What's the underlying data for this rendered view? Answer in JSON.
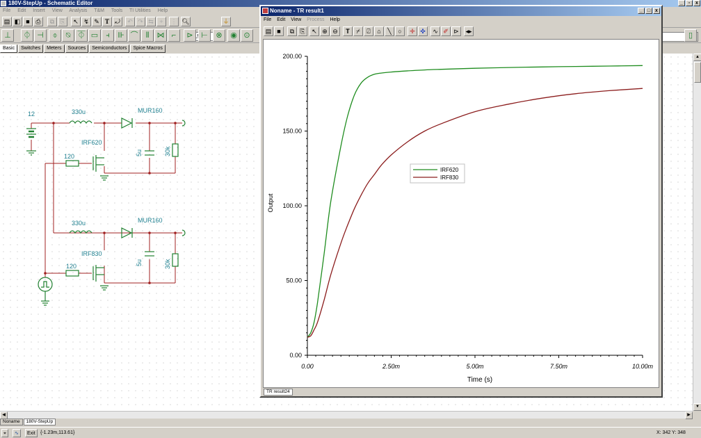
{
  "main_window": {
    "title": "180V-StepUp - Schematic Editor",
    "menu": [
      "File",
      "Edit",
      "Insert",
      "View",
      "Analysis",
      "T&M",
      "Tools",
      "TI Utilities",
      "Help"
    ],
    "zoom": "150%",
    "component_tabs": [
      "Basic",
      "Switches",
      "Meters",
      "Sources",
      "Semiconductors",
      "Spice Macros"
    ],
    "active_component_tab": "Basic",
    "document_tabs": [
      "Noname",
      "180V-StepUp"
    ],
    "active_document_tab": "180V-StepUp",
    "status_exit": "Exit",
    "status_coords": "{-1.23m,113.61}",
    "status_xy": "X: 342  Y: 348"
  },
  "schematic": {
    "source_voltage": "12",
    "circuit1": {
      "inductor": "330u",
      "diode": "MUR160",
      "mosfet": "IRF620",
      "gate_resistor": "120",
      "capacitor": "5u",
      "load_resistor": "30k"
    },
    "circuit2": {
      "inductor": "330u",
      "diode": "MUR160",
      "mosfet": "IRF830",
      "gate_resistor": "120",
      "capacitor": "5u",
      "load_resistor": "30k"
    }
  },
  "result_window": {
    "title": "Noname - TR result1",
    "menu": [
      {
        "label": "File",
        "enabled": true
      },
      {
        "label": "Edit",
        "enabled": true
      },
      {
        "label": "View",
        "enabled": true
      },
      {
        "label": "Process",
        "enabled": false
      },
      {
        "label": "Help",
        "enabled": true
      }
    ],
    "tab": "TR result24"
  },
  "chart_data": {
    "type": "line",
    "xlabel": "Time (s)",
    "ylabel": "Output",
    "xlim": [
      0,
      0.01
    ],
    "ylim": [
      0,
      200
    ],
    "x_ticks": [
      "0.00",
      "2.50m",
      "5.00m",
      "7.50m",
      "10.00m"
    ],
    "y_ticks": [
      "0.00",
      "50.00",
      "100.00",
      "150.00",
      "200.00"
    ],
    "grid": false,
    "legend_position": "center-left",
    "x": [
      0,
      0.0001,
      0.0002,
      0.0003,
      0.0005,
      0.0007,
      0.001,
      0.0012,
      0.0014,
      0.0016,
      0.0018,
      0.002,
      0.0022,
      0.0025,
      0.003,
      0.0035,
      0.004,
      0.005,
      0.006,
      0.007,
      0.008,
      0.009,
      0.01
    ],
    "series": [
      {
        "name": "IRF620",
        "color": "#1e8c1e",
        "values": [
          12,
          15,
          22,
          35,
          68,
          103,
          140,
          160,
          174,
          182,
          186,
          188,
          188.8,
          189.5,
          190.3,
          190.9,
          191.3,
          192.0,
          192.5,
          192.9,
          193.2,
          193.5,
          193.8
        ]
      },
      {
        "name": "IRF830",
        "color": "#8b1c1c",
        "values": [
          12,
          13,
          17,
          22,
          37,
          54,
          75,
          87,
          98,
          107,
          115,
          121,
          127,
          134,
          143,
          150,
          155,
          163,
          168,
          172,
          175,
          177,
          178.5
        ]
      }
    ]
  }
}
